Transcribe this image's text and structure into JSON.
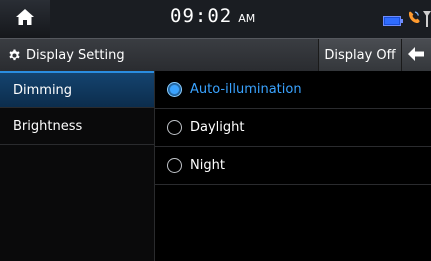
{
  "status": {
    "time": "09:02",
    "ampm": "AM",
    "icons": [
      "home-icon",
      "battery-icon",
      "bluetooth-phone-icon",
      "signal-icon"
    ]
  },
  "titlebar": {
    "title": "Display Setting",
    "title_icon": "gear-icon",
    "display_off_label": "Display Off",
    "back_icon": "back-arrow-icon"
  },
  "menu": {
    "items": [
      {
        "label": "Dimming",
        "active": true
      },
      {
        "label": "Brightness",
        "active": false
      }
    ]
  },
  "options": {
    "items": [
      {
        "label": "Auto-illumination",
        "selected": true
      },
      {
        "label": "Daylight",
        "selected": false
      },
      {
        "label": "Night",
        "selected": false
      }
    ]
  },
  "colors": {
    "accent": "#3aa3ff",
    "active_menu_bg": "#14436e",
    "background": "#000000",
    "statusbar_bg": "#1a1d22"
  }
}
